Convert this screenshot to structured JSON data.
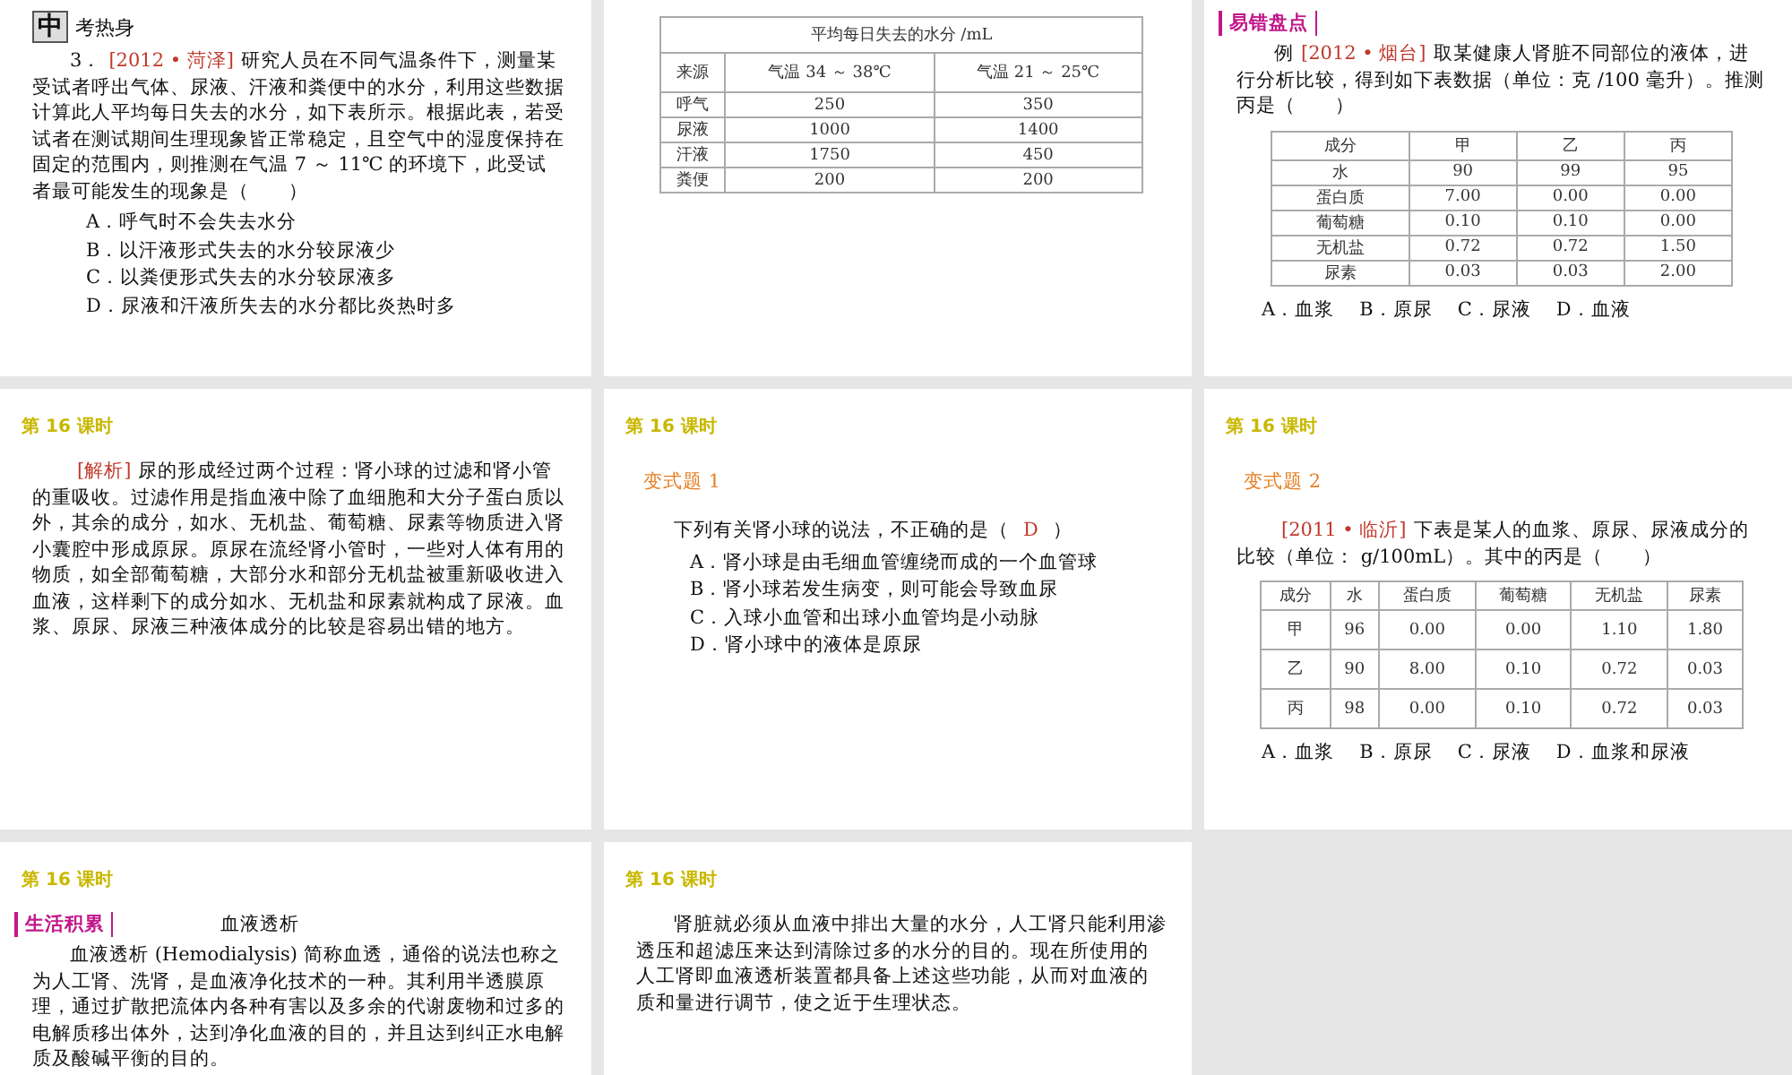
{
  "slides": [
    {
      "kind": "slide",
      "blocks": [
        {
          "kind": "badge",
          "mark": "中",
          "text": "考热身"
        },
        {
          "kind": "question",
          "prefix": "3．",
          "source": "[2012 • 菏泽]",
          "text": "研究人员在不同气温条件下，测量某受试者呼出气体、尿液、汗液和粪便中的水分，利用这些数据计算此人平均每日失去的水分，如下表所示。根据此表，若受试者在测试期间生理现象皆正常稳定，且空气中的湿度保持在固定的范围内，则推测在气温 7 ～ 11℃ 的环境下，此受试者最可能发生的现象是（　　）"
        },
        {
          "kind": "options",
          "items": [
            "A．呼气时不会失去水分",
            "B．以汗液形式失去的水分较尿液少",
            "C．以粪便形式失去的水分较尿液多",
            "D．尿液和汗液所失去的水分都比炎热时多"
          ]
        }
      ]
    },
    {
      "kind": "slide",
      "blocks": [
        {
          "kind": "table",
          "caption": "平均每日失去的水分 /mL",
          "columns": [
            "来源",
            "气温 34 ～ 38℃",
            "气温 21 ～ 25℃"
          ],
          "rows": [
            [
              "呼气",
              "250",
              "350"
            ],
            [
              "尿液",
              "1000",
              "1400"
            ],
            [
              "汗液",
              "1750",
              "450"
            ],
            [
              "粪便",
              "200",
              "200"
            ]
          ]
        }
      ]
    },
    {
      "kind": "slide",
      "blocks": [
        {
          "kind": "tag",
          "text": "易错盘点"
        },
        {
          "kind": "question",
          "prefix": "例",
          "source": "[2012 • 烟台]",
          "text": "取某健康人肾脏不同部位的液体，进行分析比较，得到如下表数据（单位：克 /100 毫升）。推测丙是（　　）"
        },
        {
          "kind": "table",
          "columns": [
            "成分",
            "甲",
            "乙",
            "丙"
          ],
          "rows": [
            [
              "水",
              "90",
              "99",
              "95"
            ],
            [
              "蛋白质",
              "7.00",
              "0.00",
              "0.00"
            ],
            [
              "葡萄糖",
              "0.10",
              "0.10",
              "0.00"
            ],
            [
              "无机盐",
              "0.72",
              "0.72",
              "1.50"
            ],
            [
              "尿素",
              "0.03",
              "0.03",
              "2.00"
            ]
          ]
        },
        {
          "kind": "options_inline",
          "items": [
            "A．血浆",
            "B．原尿",
            "C．尿液",
            "D．血液"
          ]
        }
      ]
    },
    {
      "kind": "slide",
      "blocks": [
        {
          "kind": "header",
          "text": "第 16 课时"
        },
        {
          "kind": "question",
          "source": "[解析]",
          "text": "尿的形成经过两个过程：肾小球的过滤和肾小管的重吸收。过滤作用是指血液中除了血细胞和大分子蛋白质以外，其余的成分，如水、无机盐、葡萄糖、尿素等物质进入肾小囊腔中形成原尿。原尿在流经肾小管时，一些对人体有用的物质，如全部葡萄糖，大部分水和部分无机盐被重新吸收进入血液，这样剩下的成分如水、无机盐和尿素就构成了尿液。血浆、原尿、尿液三种液体成分的比较是容易出错的地方。"
        }
      ]
    },
    {
      "kind": "slide",
      "blocks": [
        {
          "kind": "header",
          "text": "第 16 课时"
        },
        {
          "kind": "label",
          "text": "变式题 1"
        },
        {
          "kind": "answer_question",
          "text": "下列有关肾小球的说法，不正确的是（",
          "answer": "D",
          "close": "）"
        },
        {
          "kind": "options",
          "items": [
            "A．肾小球是由毛细血管缠绕而成的一个血管球",
            "B．肾小球若发生病变，则可能会导致血尿",
            "C．入球小血管和出球小血管均是小动脉",
            "D．肾小球中的液体是原尿"
          ]
        }
      ]
    },
    {
      "kind": "slide",
      "blocks": [
        {
          "kind": "header",
          "text": "第 16 课时"
        },
        {
          "kind": "label",
          "text": "变式题 2"
        },
        {
          "kind": "question",
          "source": "[2011 • 临沂]",
          "text": "下表是某人的血浆、原尿、尿液成分的比较（单位： g/100mL）。其中的丙是（　　）"
        },
        {
          "kind": "table",
          "columns": [
            "成分",
            "水",
            "蛋白质",
            "葡萄糖",
            "无机盐",
            "尿素"
          ],
          "rows": [
            [
              "甲",
              "96",
              "0.00",
              "0.00",
              "1.10",
              "1.80"
            ],
            [
              "乙",
              "90",
              "8.00",
              "0.10",
              "0.72",
              "0.03"
            ],
            [
              "丙",
              "98",
              "0.00",
              "0.10",
              "0.72",
              "0.03"
            ]
          ]
        },
        {
          "kind": "options_inline",
          "items": [
            "A．血浆",
            "B．原尿",
            "C．尿液",
            "D．血浆和尿液"
          ]
        }
      ]
    },
    {
      "kind": "slide",
      "blocks": [
        {
          "kind": "header",
          "text": "第 16 课时"
        },
        {
          "kind": "tag",
          "text": "生活积累",
          "title": "血液透析"
        },
        {
          "kind": "paragraph",
          "text": "血液透析 (Hemodialysis) 简称血透，通俗的说法也称之为人工肾、洗肾，是血液净化技术的一种。其利用半透膜原理，通过扩散把流体内各种有害以及多余的代谢废物和过多的电解质移出体外，达到净化血液的目的，并且达到纠正水电解质及酸碱平衡的目的。"
        }
      ]
    },
    {
      "kind": "slide",
      "blocks": [
        {
          "kind": "header",
          "text": "第 16 课时"
        },
        {
          "kind": "paragraph",
          "text": "肾脏就必须从血液中排出大量的水分，人工肾只能利用渗透压和超滤压来达到清除过多的水分的目的。现在所使用的人工肾即血液透析装置都具备上述这些功能，从而对血液的质和量进行调节，使之近于生理状态。"
        }
      ]
    },
    {
      "kind": "empty"
    }
  ]
}
